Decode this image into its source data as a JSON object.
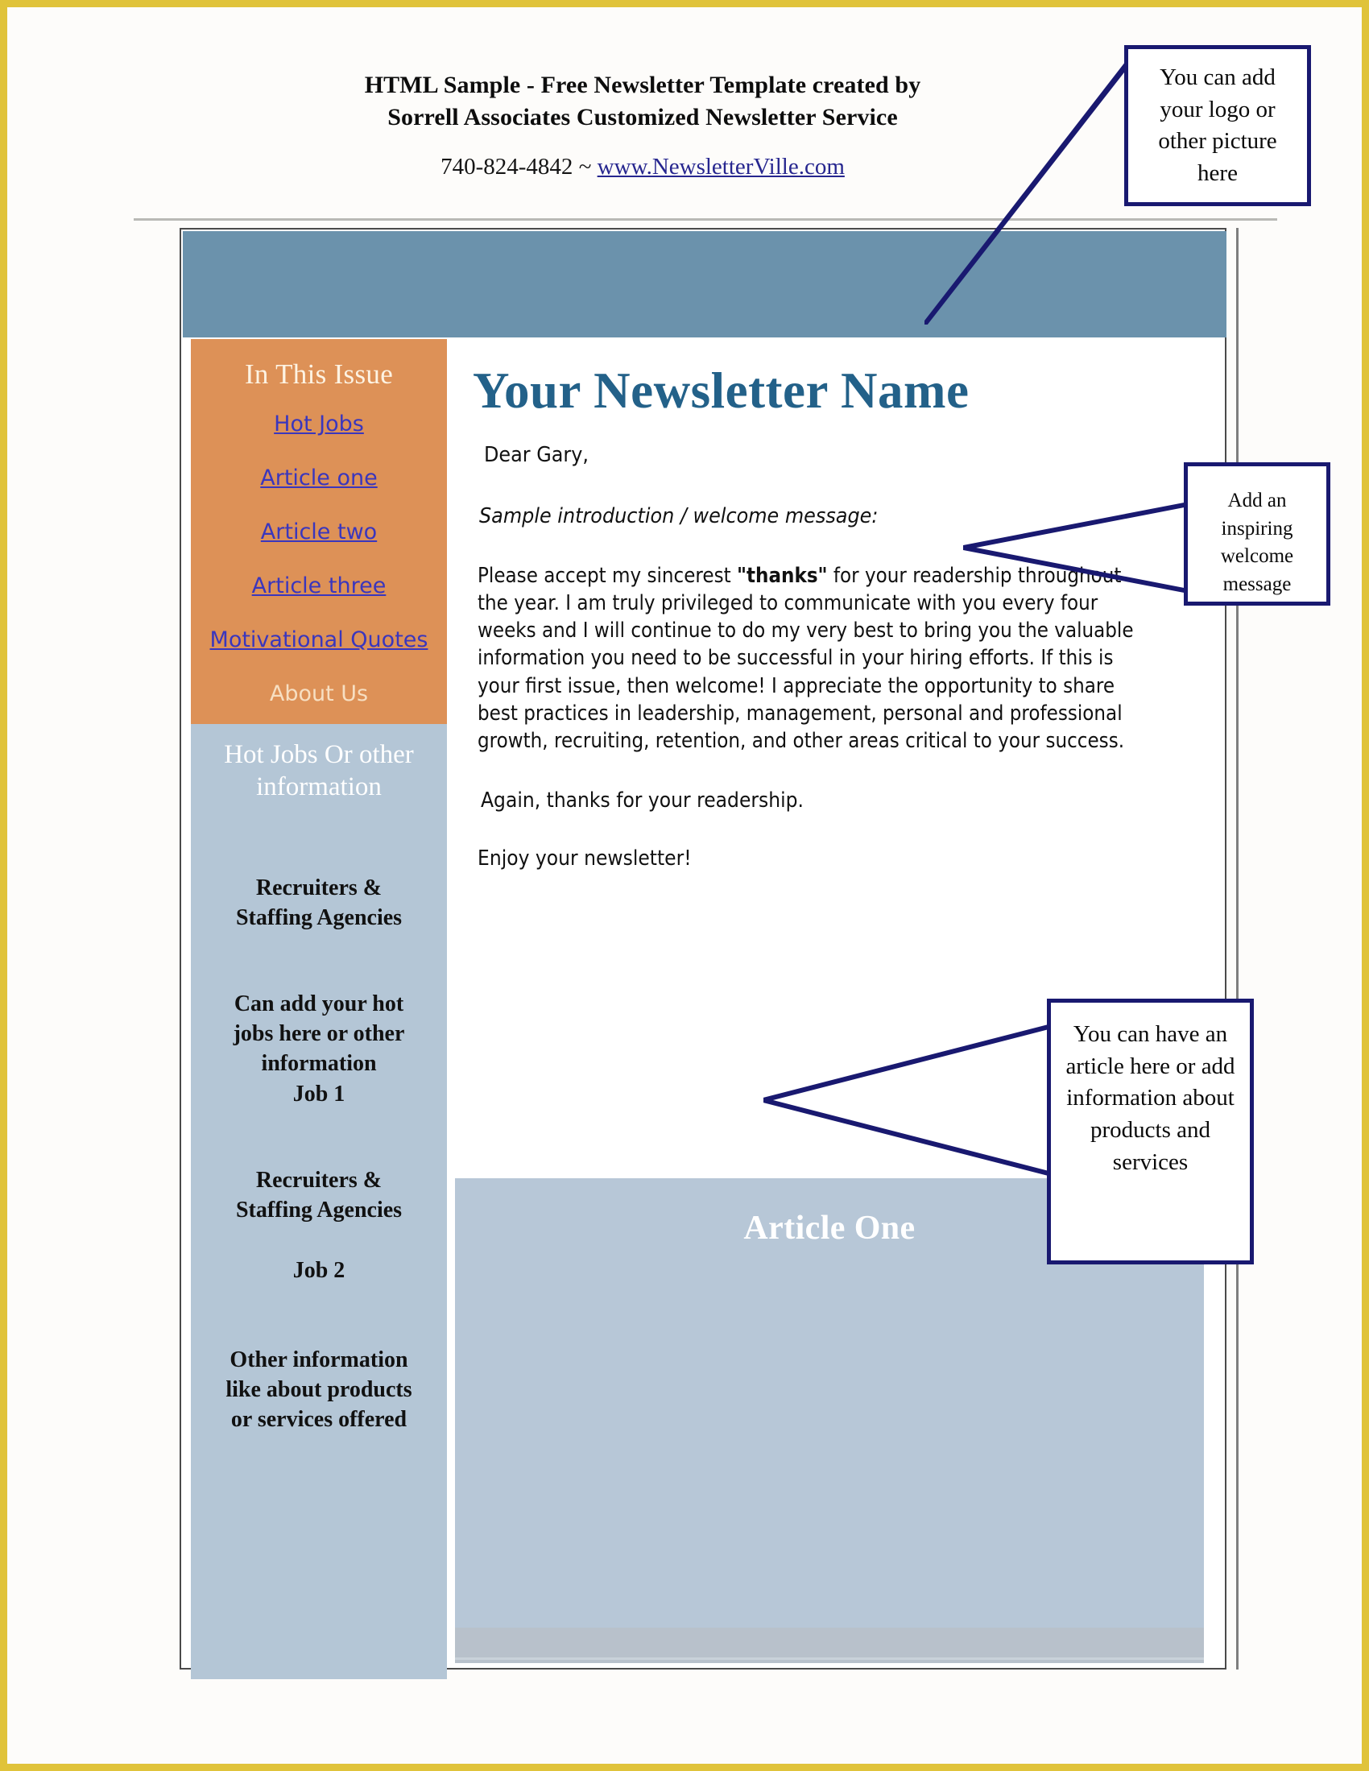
{
  "page": {
    "border_color": "#e0c33a",
    "background": "#fdfcfa"
  },
  "masthead": {
    "line1": "HTML Sample - Free Newsletter Template created by",
    "line2": "Sorrell Associates Customized Newsletter Service",
    "phone": "740-824-4842",
    "separator": " ~ ",
    "website": "www.NewsletterVille.com"
  },
  "banner": {
    "color": "#6b92ac"
  },
  "sidebar": {
    "issue": {
      "title": "In This Issue",
      "background": "#dd9157",
      "links": [
        {
          "label": "Hot Jobs"
        },
        {
          "label": "Article one"
        },
        {
          "label": "Article two"
        },
        {
          "label": "Article three"
        },
        {
          "label": "Motivational Quotes"
        }
      ],
      "about_label": "About Us"
    },
    "hotjobs": {
      "title": "Hot Jobs Or other information",
      "background": "#b4c6d6",
      "blocks": [
        "Recruiters &\nStaffing Agencies",
        "Can add your hot\njobs here or other\ninformation\nJob 1",
        "Recruiters &\nStaffing Agencies\n\nJob 2",
        "Other information\nlike about products\nor services offered"
      ]
    }
  },
  "content": {
    "newsletter_name": "Your Newsletter Name",
    "newsletter_name_color": "#236189",
    "salutation": "Dear Gary,",
    "intro_line": "Sample introduction / welcome message:",
    "body_before": "Please accept my sincerest ",
    "body_bold": "\"thanks\"",
    "body_after": " for your readership throughout the year. I am truly privileged to communicate with you every four weeks and I will continue to do my very best to bring you the valuable information you need to be successful in your hiring efforts. If this is your first issue, then welcome! I appreciate the opportunity to share best practices in leadership, management, personal and professional growth, recruiting, retention, and other areas critical to your success.",
    "again_line": "Again, thanks for your readership.",
    "enjoy_line": "Enjoy your newsletter!",
    "article": {
      "title": "Article One",
      "background": "#b7c7d7"
    }
  },
  "callouts": {
    "logo": "You can add your logo or other picture here",
    "welcome": "Add an inspiring welcome message",
    "article": "You can have an article here or add information about products and services",
    "border_color": "#191970"
  }
}
